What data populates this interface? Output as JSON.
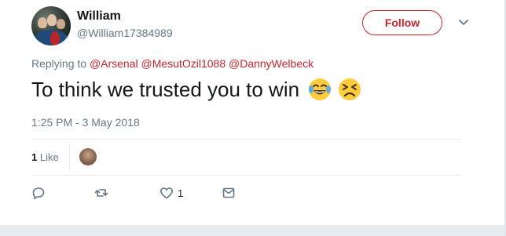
{
  "user": {
    "name": "William",
    "handle": "@William17384989"
  },
  "follow_label": "Follow",
  "replying": {
    "prefix": "Replying to",
    "mentions": [
      "@Arsenal",
      "@MesutOzil1088",
      "@DannyWelbeck"
    ]
  },
  "tweet": {
    "text": "To think we trusted you to win",
    "emojis": [
      "face-with-tears-of-joy",
      "tired-face"
    ]
  },
  "timestamp": "1:25 PM - 3 May 2018",
  "likes": {
    "count": "1",
    "label": "Like"
  },
  "actions": {
    "reply_icon": "reply-icon",
    "retweet_icon": "retweet-icon",
    "like_icon": "heart-icon",
    "like_count": "1",
    "dm_icon": "envelope-icon"
  },
  "colors": {
    "accent": "#c0272d",
    "muted": "#657786",
    "text": "#14171a",
    "divider": "#e6ecf0"
  }
}
